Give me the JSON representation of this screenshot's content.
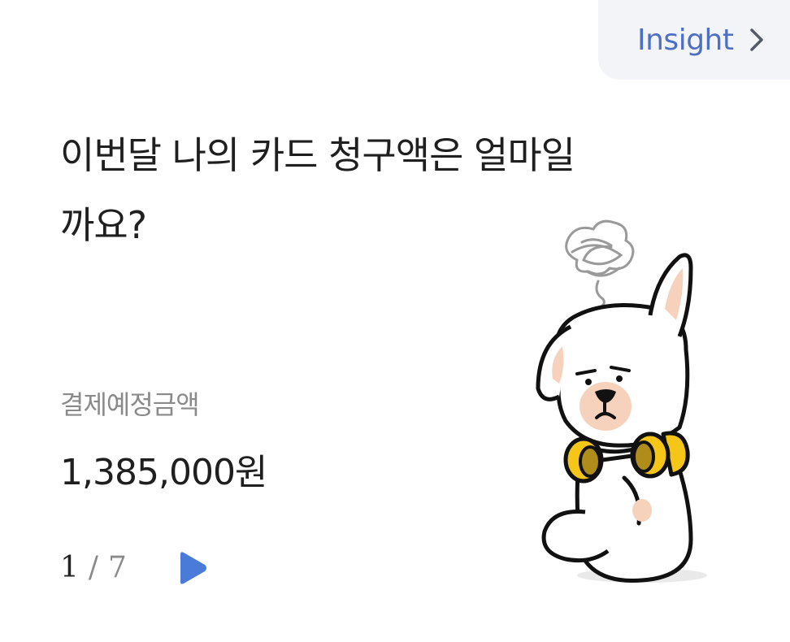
{
  "insight": {
    "label": "Insight",
    "chevron_icon": "chevron-right-icon"
  },
  "headline": {
    "line1": "이번달 나의 카드 청구액은 얼마일",
    "line2": "까요?"
  },
  "payment": {
    "label": "결제예정금액",
    "amount": "1,385,000원"
  },
  "pager": {
    "current": "1",
    "separator": "/",
    "total": "7",
    "play_icon": "play-icon"
  },
  "illustration": {
    "icon": "grumpy-dog-with-headphones-icon"
  },
  "colors": {
    "accent": "#4d6fc4",
    "play": "#4a7bd9",
    "tab_bg": "#f3f4f7",
    "headphone": "#f5c518"
  }
}
